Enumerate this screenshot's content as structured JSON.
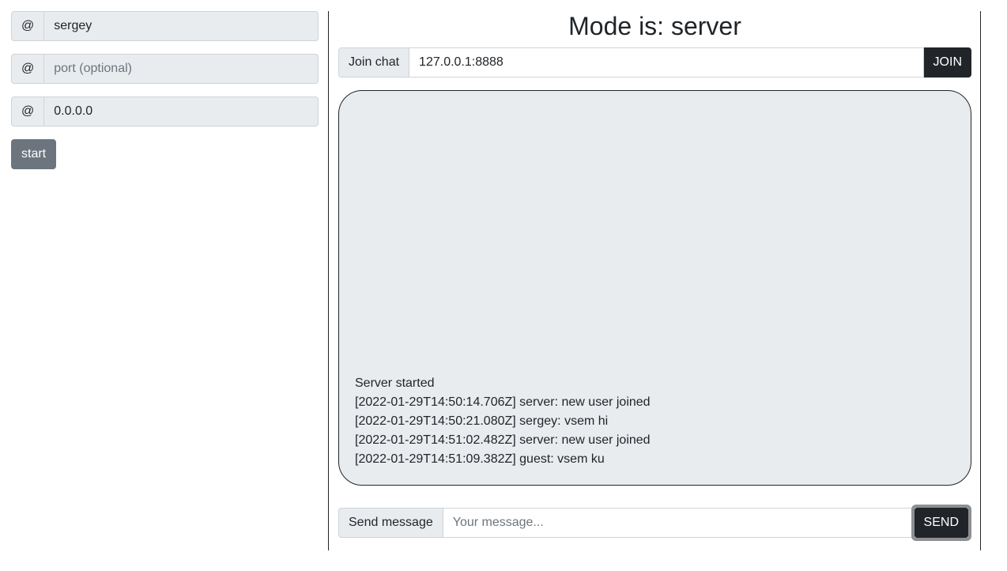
{
  "left_panel": {
    "fields": [
      {
        "addon": "@",
        "value": "sergey",
        "placeholder": ""
      },
      {
        "addon": "@",
        "value": "",
        "placeholder": "port (optional)"
      },
      {
        "addon": "@",
        "value": "0.0.0.0",
        "placeholder": ""
      }
    ],
    "start_label": "start"
  },
  "right_panel": {
    "title": "Mode is: server",
    "join": {
      "label": "Join chat",
      "value": "127.0.0.1:8888",
      "button": "JOIN"
    },
    "messages": [
      "Server started",
      "[2022-01-29T14:50:14.706Z] server: new user joined",
      "[2022-01-29T14:50:21.080Z] sergey: vsem hi",
      "[2022-01-29T14:51:02.482Z] server: new user joined",
      "[2022-01-29T14:51:09.382Z] guest: vsem ku"
    ],
    "send": {
      "label": "Send message",
      "placeholder": "Your message...",
      "value": "",
      "button": "SEND"
    }
  }
}
